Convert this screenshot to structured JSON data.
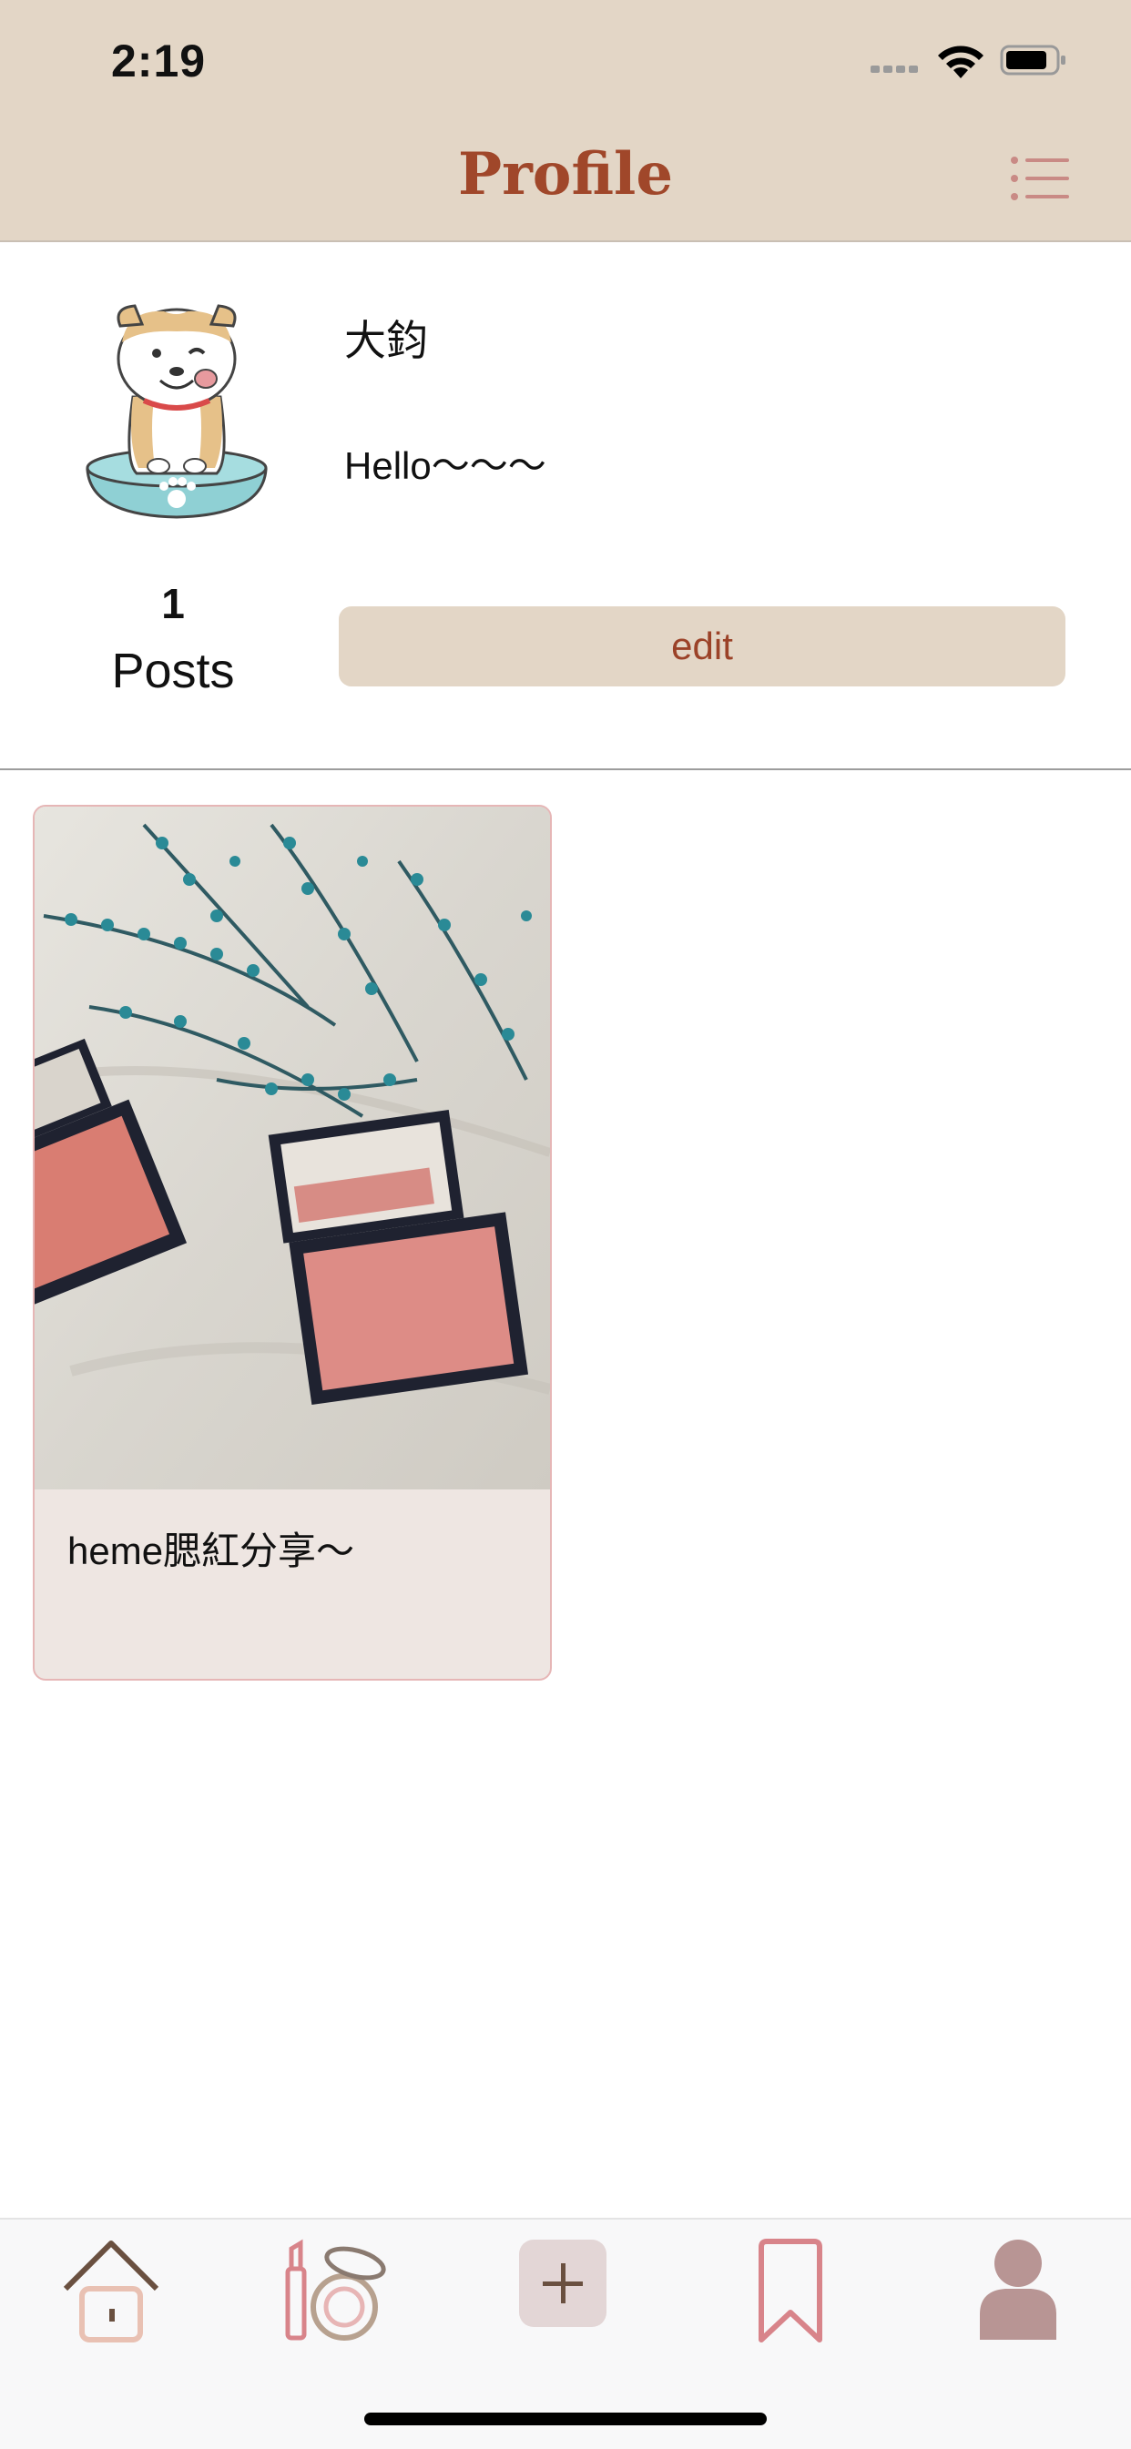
{
  "status_bar": {
    "time": "2:19",
    "signal_icon": "signal-dots-icon",
    "wifi_icon": "wifi-icon",
    "battery_icon": "battery-icon"
  },
  "nav": {
    "title": "Profile",
    "menu_icon": "list-menu-icon"
  },
  "profile": {
    "avatar_icon": "dog-in-bowl-avatar",
    "username": "大鈞",
    "bio": "Hello～～～",
    "post_count": "1",
    "post_label": "Posts",
    "edit_label": "edit"
  },
  "posts": [
    {
      "caption": "heme腮紅分享～",
      "image": "blush-palettes-photo"
    }
  ],
  "tab_bar": {
    "items": [
      {
        "icon": "home-icon"
      },
      {
        "icon": "makeup-icon"
      },
      {
        "icon": "add-post-icon"
      },
      {
        "icon": "bookmark-icon"
      },
      {
        "icon": "profile-icon"
      }
    ]
  },
  "colors": {
    "header_bg": "#e3d6c6",
    "accent": "#a0472a",
    "card_bg": "#eee6e2",
    "card_border": "#e6b6b6",
    "profile_tab": "#b89594"
  }
}
